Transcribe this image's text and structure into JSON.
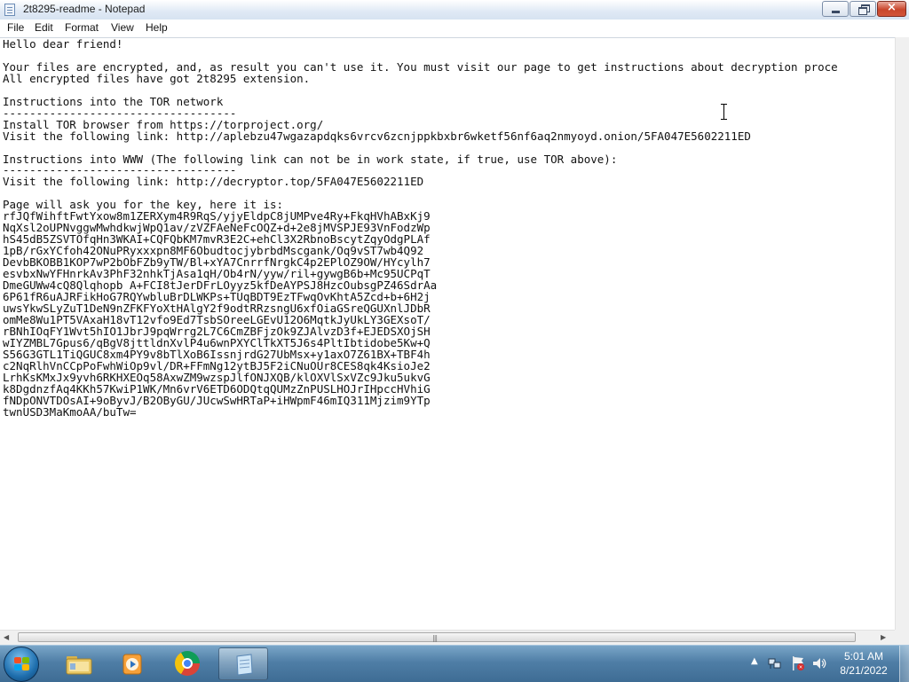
{
  "window": {
    "title": "2t8295-readme - Notepad",
    "close_glyph": "×"
  },
  "menu": {
    "file": "File",
    "edit": "Edit",
    "format": "Format",
    "view": "View",
    "help": "Help"
  },
  "document": {
    "lines": [
      "Hello dear friend!",
      "",
      "Your files are encrypted, and, as result you can't use it. You must visit our page to get instructions about decryption proce",
      "All encrypted files have got 2t8295 extension.",
      "",
      "Instructions into the TOR network",
      "-----------------------------------",
      "Install TOR browser from https://torproject.org/",
      "Visit the following link: http://aplebzu47wgazapdqks6vrcv6zcnjppkbxbr6wketf56nf6aq2nmyoyd.onion/5FA047E5602211ED",
      "",
      "Instructions into WWW (The following link can not be in work state, if true, use TOR above):",
      "-----------------------------------",
      "Visit the following link: http://decryptor.top/5FA047E5602211ED",
      "",
      "Page will ask you for the key, here it is:",
      "rfJQfWihftFwtYxow8m1ZERXym4R9RqS/yjyEldpC8jUMPve4Ry+FkqHVhABxKj9",
      "NqXsl2oUPNvggwMwhdkwjWpQ1av/zVZFAeNeFcOQZ+d+2e8jMVSPJE93VnFodzWp",
      "hS45dB5ZSVTOfqHn3WKAI+CQFQbKM7mvR3E2C+ehCl3X2RbnoBscytZqyOdgPLAf",
      "1pB/rGxYCfoh42ONuPRyxxxpn8MF6ObudtocjybrbdMscgank/Oq9vST7wb4Q92",
      "DevbBKOBB1KOP7wP2bObFZb9yTW/Bl+xYA7CnrrfNrgkC4p2EPlOZ9OW/HYcylh7",
      "esvbxNwYFHnrkAv3PhF32nhkTjAsa1qH/Ob4rN/yyw/ril+gywgB6b+Mc95UCPqT",
      "DmeGUWw4cQ8Qlqhopb A+FCI8tJerDFrLOyyz5kfDeAYPSJ8HzcOubsgPZ46SdrAa",
      "6P61fR6uAJRFikHoG7RQYwbluBrDLWKPs+TUqBDT9EzTFwqOvKhtA5Zcd+b+6H2j",
      "uwsYkwSLyZuT1DeN9nZFKFYoXtHAlgY2f9odtRRzsngU6xfOiaGSreQGUXnlJDbR",
      "omMe8Wu1PT5VAxaH18vT12vfo9Ed7TsbSOreeLGEvU12O6MqtkJyUkLY3GEXsoT/",
      "rBNhIOqFY1Wvt5hIO1JbrJ9pqWrrg2L7C6CmZBFjzOk9ZJAlvzD3f+EJEDSXOjSH",
      "wIYZMBL7Gpus6/qBgV8jttldnXvlP4u6wnPXYClTkXT5J6s4PltIbtidobe5Kw+Q",
      "S56G3GTL1TiQGUC8xm4PY9v8bTlXoB6IssnjrdG27UbMsx+y1axO7Z61BX+TBF4h",
      "c2NqRlhVnCCpPoFwhWiOp9vl/DR+FFmNg12ytBJ5F2iCNuOUr8CES8qk4KsioJe2",
      "LrhKsKMxJx9yvh6RKHXEOq58AxwZM9wzspJlfONJXQB/klOXVlSxVZc9Jku5ukvG",
      "k8DgdnzfAq4KKh57KwiP1WK/Mn6vrV6ETD6ODQtqQUMzZnPUSLHOJrIHpccHVhiG",
      "fNDpONVTDOsAI+9oByvJ/B2OByGU/JUcwSwHRTaP+iHWpmF46mIQ311Mjzim9YTp",
      "twnUSD3MaKmoAA/buTw="
    ]
  },
  "taskbar": {
    "items": [
      {
        "name": "Windows Explorer",
        "icon": "folder-icon"
      },
      {
        "name": "Windows Media Player",
        "icon": "media-player-icon"
      },
      {
        "name": "Google Chrome",
        "icon": "chrome-icon"
      },
      {
        "name": "Notepad",
        "icon": "notepad-icon",
        "active": true
      }
    ],
    "tray": {
      "chevron_glyph": "▲",
      "time": "5:01 AM",
      "date": "8/21/2022"
    }
  },
  "colors": {
    "taskbar": "#4f7ea6",
    "title_bar": "#dfe9f5",
    "close_button": "#c9462c"
  }
}
